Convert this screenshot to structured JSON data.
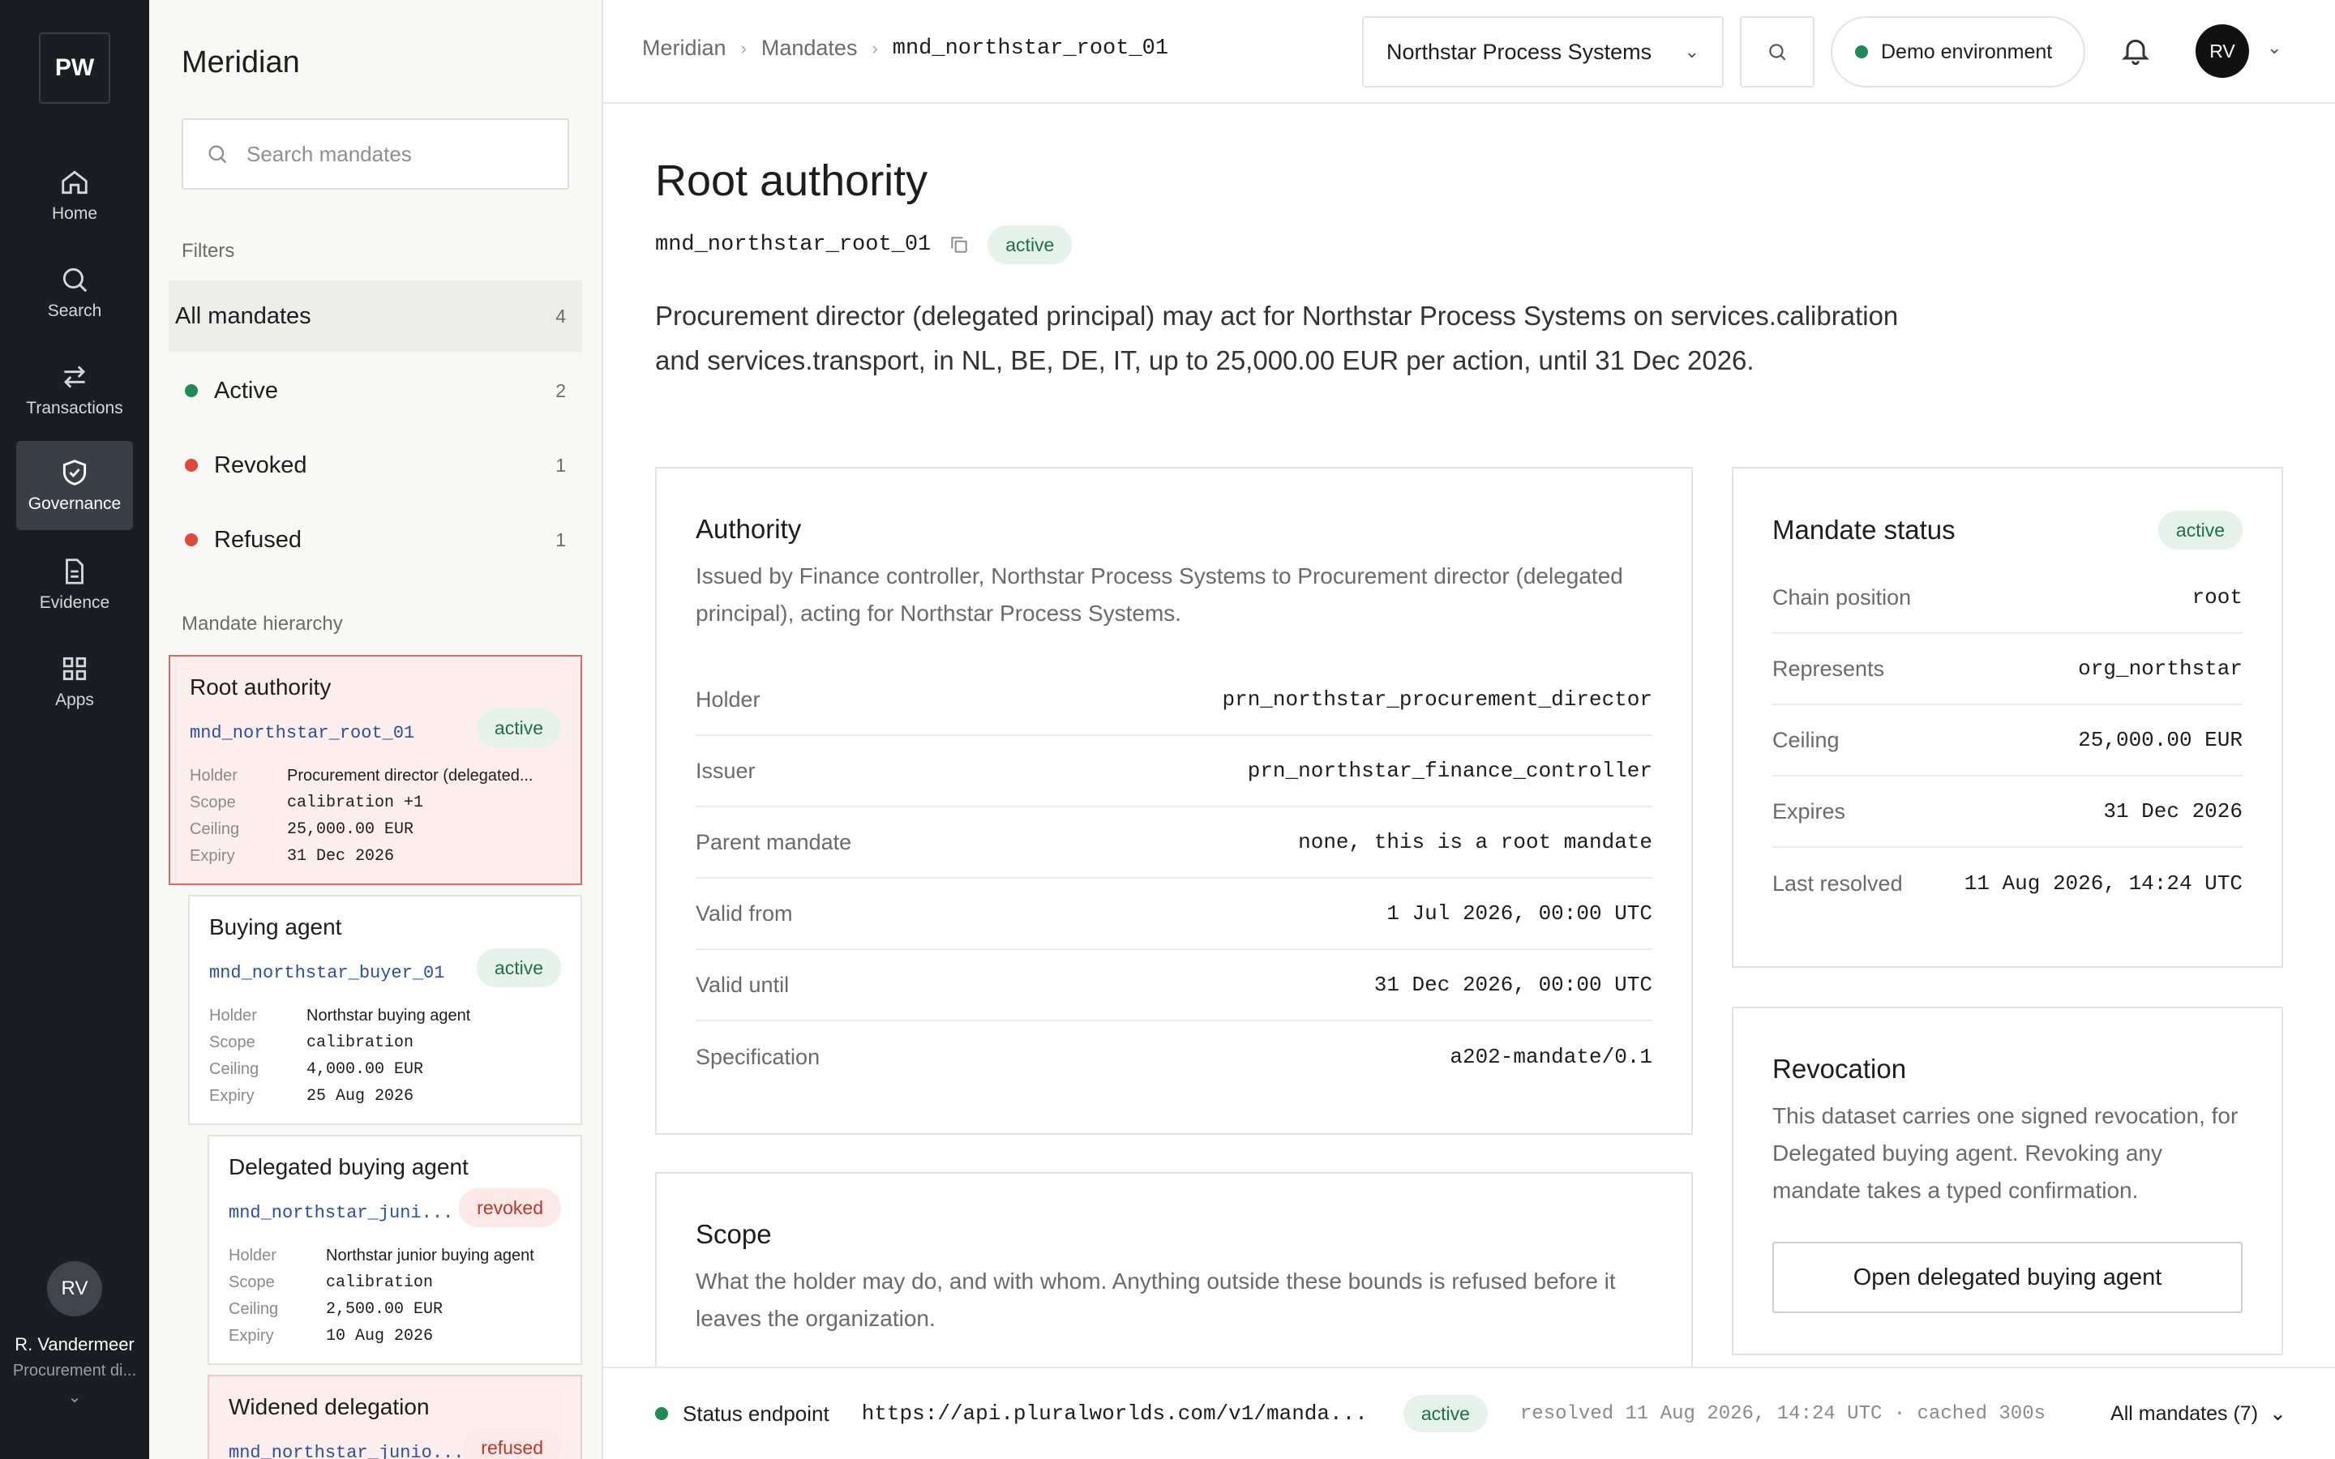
{
  "rail": {
    "logo": "PW",
    "items": [
      {
        "label": "Home",
        "icon": "home-icon"
      },
      {
        "label": "Search",
        "icon": "search-icon"
      },
      {
        "label": "Transactions",
        "icon": "transfer-icon"
      },
      {
        "label": "Governance",
        "icon": "shield-icon",
        "active": true
      },
      {
        "label": "Evidence",
        "icon": "document-icon"
      },
      {
        "label": "Apps",
        "icon": "grid-icon"
      }
    ],
    "user": {
      "initials": "RV",
      "name": "R. Vandermeer",
      "role": "Procurement di..."
    }
  },
  "panel": {
    "title": "Meridian",
    "search_placeholder": "Search mandates",
    "filters_label": "Filters",
    "filters": [
      {
        "label": "All mandates",
        "count": "4"
      },
      {
        "label": "Active",
        "count": "2",
        "color": "#1e8a55"
      },
      {
        "label": "Revoked",
        "count": "1",
        "color": "#e0483b"
      },
      {
        "label": "Refused",
        "count": "1",
        "color": "#e0483b"
      }
    ],
    "hierarchy_label": "Mandate hierarchy",
    "cards": [
      {
        "title": "Root authority",
        "id": "mnd_northstar_root_01",
        "status": "active",
        "holder": "Procurement director (delegated...",
        "scope": "calibration +1",
        "ceiling": "25,000.00 EUR",
        "expiry": "31 Dec 2026"
      },
      {
        "title": "Buying agent",
        "id": "mnd_northstar_buyer_01",
        "status": "active",
        "holder": "Northstar buying agent",
        "scope": "calibration",
        "ceiling": "4,000.00 EUR",
        "expiry": "25 Aug 2026"
      },
      {
        "title": "Delegated buying agent",
        "id": "mnd_northstar_juni...",
        "status": "revoked",
        "holder": "Northstar junior buying agent",
        "scope": "calibration",
        "ceiling": "2,500.00 EUR",
        "expiry": "10 Aug 2026"
      },
      {
        "title": "Widened delegation",
        "id": "mnd_northstar_junio...",
        "status": "refused"
      }
    ],
    "row_labels": {
      "holder": "Holder",
      "scope": "Scope",
      "ceiling": "Ceiling",
      "expiry": "Expiry"
    }
  },
  "topbar": {
    "crumbs": [
      "Meridian",
      "Mandates",
      "mnd_northstar_root_01"
    ],
    "org": "Northstar Process Systems",
    "env": "Demo environment",
    "avatar": "RV"
  },
  "main": {
    "title": "Root authority",
    "id": "mnd_northstar_root_01",
    "status": "active",
    "summary": "Procurement director (delegated principal) may act for Northstar Process Systems on services.calibration and services.transport, in NL, BE, DE, IT, up to 25,000.00 EUR per action, until 31 Dec 2026.",
    "authority": {
      "title": "Authority",
      "desc": "Issued by Finance controller, Northstar Process Systems to Procurement director (delegated principal), acting for Northstar Process Systems.",
      "rows": [
        {
          "k": "Holder",
          "v": "prn_northstar_procurement_director"
        },
        {
          "k": "Issuer",
          "v": "prn_northstar_finance_controller"
        },
        {
          "k": "Parent mandate",
          "v": "none, this is a root mandate"
        },
        {
          "k": "Valid from",
          "v": "1 Jul 2026, 00:00 UTC"
        },
        {
          "k": "Valid until",
          "v": "31 Dec 2026, 00:00 UTC"
        },
        {
          "k": "Specification",
          "v": "a202-mandate/0.1"
        }
      ]
    },
    "scope": {
      "title": "Scope",
      "desc": "What the holder may do, and with whom. Anything outside these bounds is refused before it leaves the organization."
    },
    "status_box": {
      "title": "Mandate status",
      "badge": "active",
      "rows": [
        {
          "k": "Chain position",
          "v": "root"
        },
        {
          "k": "Represents",
          "v": "org_northstar"
        },
        {
          "k": "Ceiling",
          "v": "25,000.00 EUR"
        },
        {
          "k": "Expires",
          "v": "31 Dec 2026"
        },
        {
          "k": "Last resolved",
          "v": "11 Aug 2026, 14:24 UTC"
        }
      ]
    },
    "revocation": {
      "title": "Revocation",
      "desc": "This dataset carries one signed revocation, for Delegated buying agent. Revoking any mandate takes a typed confirmation.",
      "button": "Open delegated buying agent"
    }
  },
  "footer": {
    "label": "Status endpoint",
    "url": "https://api.pluralworlds.com/v1/manda...",
    "badge": "active",
    "meta": "resolved 11 Aug 2026, 14:24 UTC · cached 300s",
    "all": "All mandates (7)"
  },
  "colors": {
    "rail": "#1b1d22",
    "active_green": "#1e8a55",
    "red": "#e0483b",
    "link_blue": "#2b4fa3"
  }
}
